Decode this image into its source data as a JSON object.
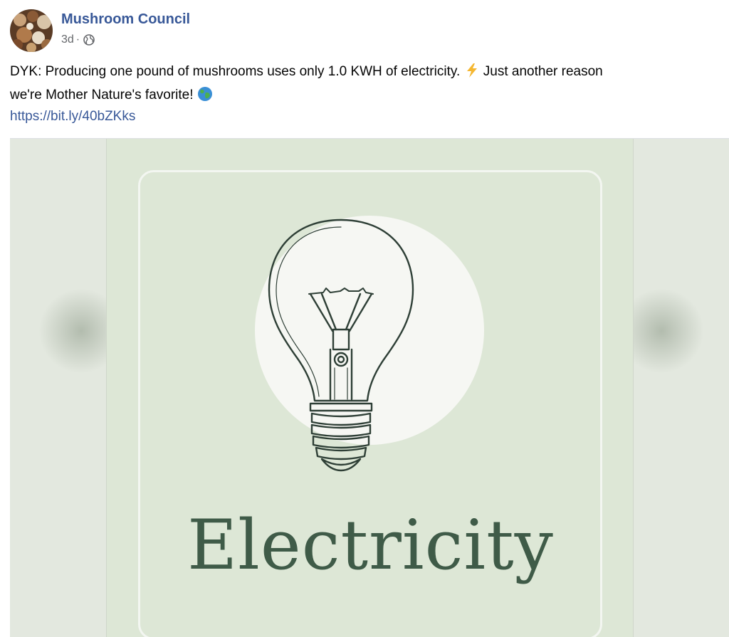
{
  "post": {
    "author": "Mushroom Council",
    "timestamp": "3d",
    "separator": "·",
    "audience_icon": "globe-icon",
    "text_line1": "DYK: Producing one pound of mushrooms uses only 1.0 KWH of electricity.",
    "text_line1b": "Just another reason",
    "text_line2": "we're Mother Nature's favorite!",
    "link": "https://bit.ly/40bZKks"
  },
  "media": {
    "word": "Electricity"
  },
  "colors": {
    "link": "#385898",
    "card_bg": "#dde7d6",
    "word": "#3f5b48"
  }
}
